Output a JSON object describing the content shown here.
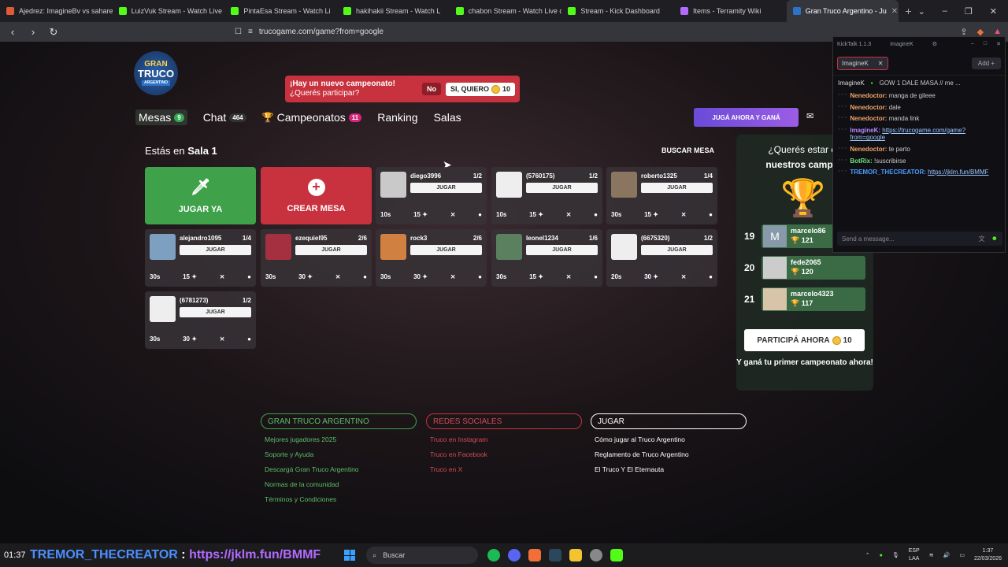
{
  "browser": {
    "tabs": [
      {
        "label": "Ajedrez: ImagineBv vs sahareh",
        "color": "#e05a3a"
      },
      {
        "label": "LuizVuk Stream - Watch Live o",
        "color": "#53fc18"
      },
      {
        "label": "PintaEsa Stream - Watch Li",
        "color": "#53fc18"
      },
      {
        "label": "hakihakii Stream - Watch L",
        "color": "#53fc18"
      },
      {
        "label": "chabon Stream - Watch Live o",
        "color": "#53fc18"
      },
      {
        "label": "Stream - Kick Dashboard",
        "color": "#53fc18"
      },
      {
        "label": "Items - Terramity Wiki",
        "color": "#b36bff"
      },
      {
        "label": "Gran Truco Argentino - Ju",
        "color": "#2b73c8"
      }
    ],
    "url": "trucogame.com/game?from=google"
  },
  "logo": {
    "l1": "GRAN",
    "l2": "TRUCO",
    "l3": "ARGENTINO"
  },
  "banner": {
    "title": "¡Hay un nuevo campeonato!",
    "subtitle": "¿Querés participar?",
    "no": "No",
    "yes": "SI, QUIERO",
    "yes_coins": "10"
  },
  "nav": {
    "mesas": "Mesas",
    "mesas_badge": "9",
    "chat": "Chat",
    "chat_badge": "464",
    "campeonatos": "Campeonatos",
    "campeonatos_badge": "11",
    "ranking": "Ranking",
    "salas": "Salas",
    "juga_ahora": "JUGÁ AHORA Y GANÁ"
  },
  "sala": {
    "prefix": "Estás en ",
    "name": "Sala 1",
    "buscar": "BUSCAR MESA"
  },
  "actions": {
    "jugar_ya": "JUGAR YA",
    "crear_mesa": "CREAR MESA"
  },
  "mesas": [
    {
      "name": "diego3996",
      "count": "1/2",
      "time": "10s",
      "pts": "15",
      "jugar": "JUGAR"
    },
    {
      "name": "(5760175)",
      "count": "1/2",
      "time": "10s",
      "pts": "15",
      "jugar": "JUGAR"
    },
    {
      "name": "roberto1325",
      "count": "1/4",
      "time": "30s",
      "pts": "15",
      "jugar": "JUGAR"
    },
    {
      "name": "alejandro1095",
      "count": "1/4",
      "time": "30s",
      "pts": "15",
      "jugar": "JUGAR"
    },
    {
      "name": "ezequiel95",
      "count": "2/6",
      "time": "30s",
      "pts": "30",
      "jugar": "JUGAR"
    },
    {
      "name": "rock3",
      "count": "2/6",
      "time": "30s",
      "pts": "30",
      "jugar": "JUGAR"
    },
    {
      "name": "leonel1234",
      "count": "1/6",
      "time": "30s",
      "pts": "15",
      "jugar": "JUGAR"
    },
    {
      "name": "(6675320)",
      "count": "1/2",
      "time": "20s",
      "pts": "30",
      "jugar": "JUGAR"
    },
    {
      "name": "(6781273)",
      "count": "1/2",
      "time": "30s",
      "pts": "30",
      "jugar": "JUGAR"
    }
  ],
  "champ": {
    "q1": "¿Querés estar en",
    "q2": "nuestros campeo",
    "ranks": [
      {
        "pos": "19",
        "name": "marcelo86",
        "score": "121",
        "initial": "M"
      },
      {
        "pos": "20",
        "name": "fede2065",
        "score": "120",
        "initial": ""
      },
      {
        "pos": "21",
        "name": "marcelo4323",
        "score": "117",
        "initial": ""
      }
    ],
    "participa": "PARTICIPÁ AHORA",
    "participa_coins": "10",
    "foot": "Y ganá tu primer campeonato ahora!"
  },
  "footer": {
    "col1": {
      "head": "GRAN TRUCO ARGENTINO",
      "links": [
        "Mejores jugadores 2025",
        "Soporte y Ayuda",
        "Descargá Gran Truco Argentino",
        "Normas de la comunidad",
        "Términos y Condiciones"
      ]
    },
    "col2": {
      "head": "REDES SOCIALES",
      "links": [
        "Truco en Instagram",
        "Truco en Facebook",
        "Truco en X"
      ]
    },
    "col3": {
      "head": "JUGAR",
      "links": [
        "Cómo jugar al Truco Argentino",
        "Reglamento de Truco Argentino",
        "El Truco Y El Eternauta"
      ]
    }
  },
  "kicktalk": {
    "title": "KickTalk 1.1.3",
    "user": "ImagineK",
    "chip": "ImagineK",
    "add": "Add",
    "stream_user": "ImagineK",
    "stream_title": "GOW 1 DALE MASA // me ...",
    "messages": [
      {
        "user": "Nenedoctor:",
        "text": "manga de gileee",
        "cls": "u-orange"
      },
      {
        "user": "Nenedoctor:",
        "text": "dale",
        "cls": "u-orange"
      },
      {
        "user": "Nenedoctor:",
        "text": "manda link",
        "cls": "u-orange"
      },
      {
        "user": "ImagineK:",
        "text": "https://trucogame.com/game?from=google",
        "cls": "u-purple",
        "link": true
      },
      {
        "user": "Nenedoctor:",
        "text": "te parto",
        "cls": "u-orange"
      },
      {
        "user": "BotRix:",
        "text": "!suscribirse",
        "cls": "u-green"
      },
      {
        "user": "TREMOR_THECREATOR:",
        "text": "https://jklm.fun/BMMF",
        "cls": "u-blue",
        "link": true
      }
    ],
    "placeholder": "Send a message..."
  },
  "taskbar": {
    "time_left": "01:37",
    "overlay_user": "TREMOR_THECREATOR",
    "overlay_sep": " : ",
    "overlay_link": "https://jklm.fun/BMMF",
    "search": "Buscar",
    "lang1": "ESP",
    "lang2": "LAA",
    "clock_time": "1:37",
    "clock_date": "22/03/2026"
  }
}
